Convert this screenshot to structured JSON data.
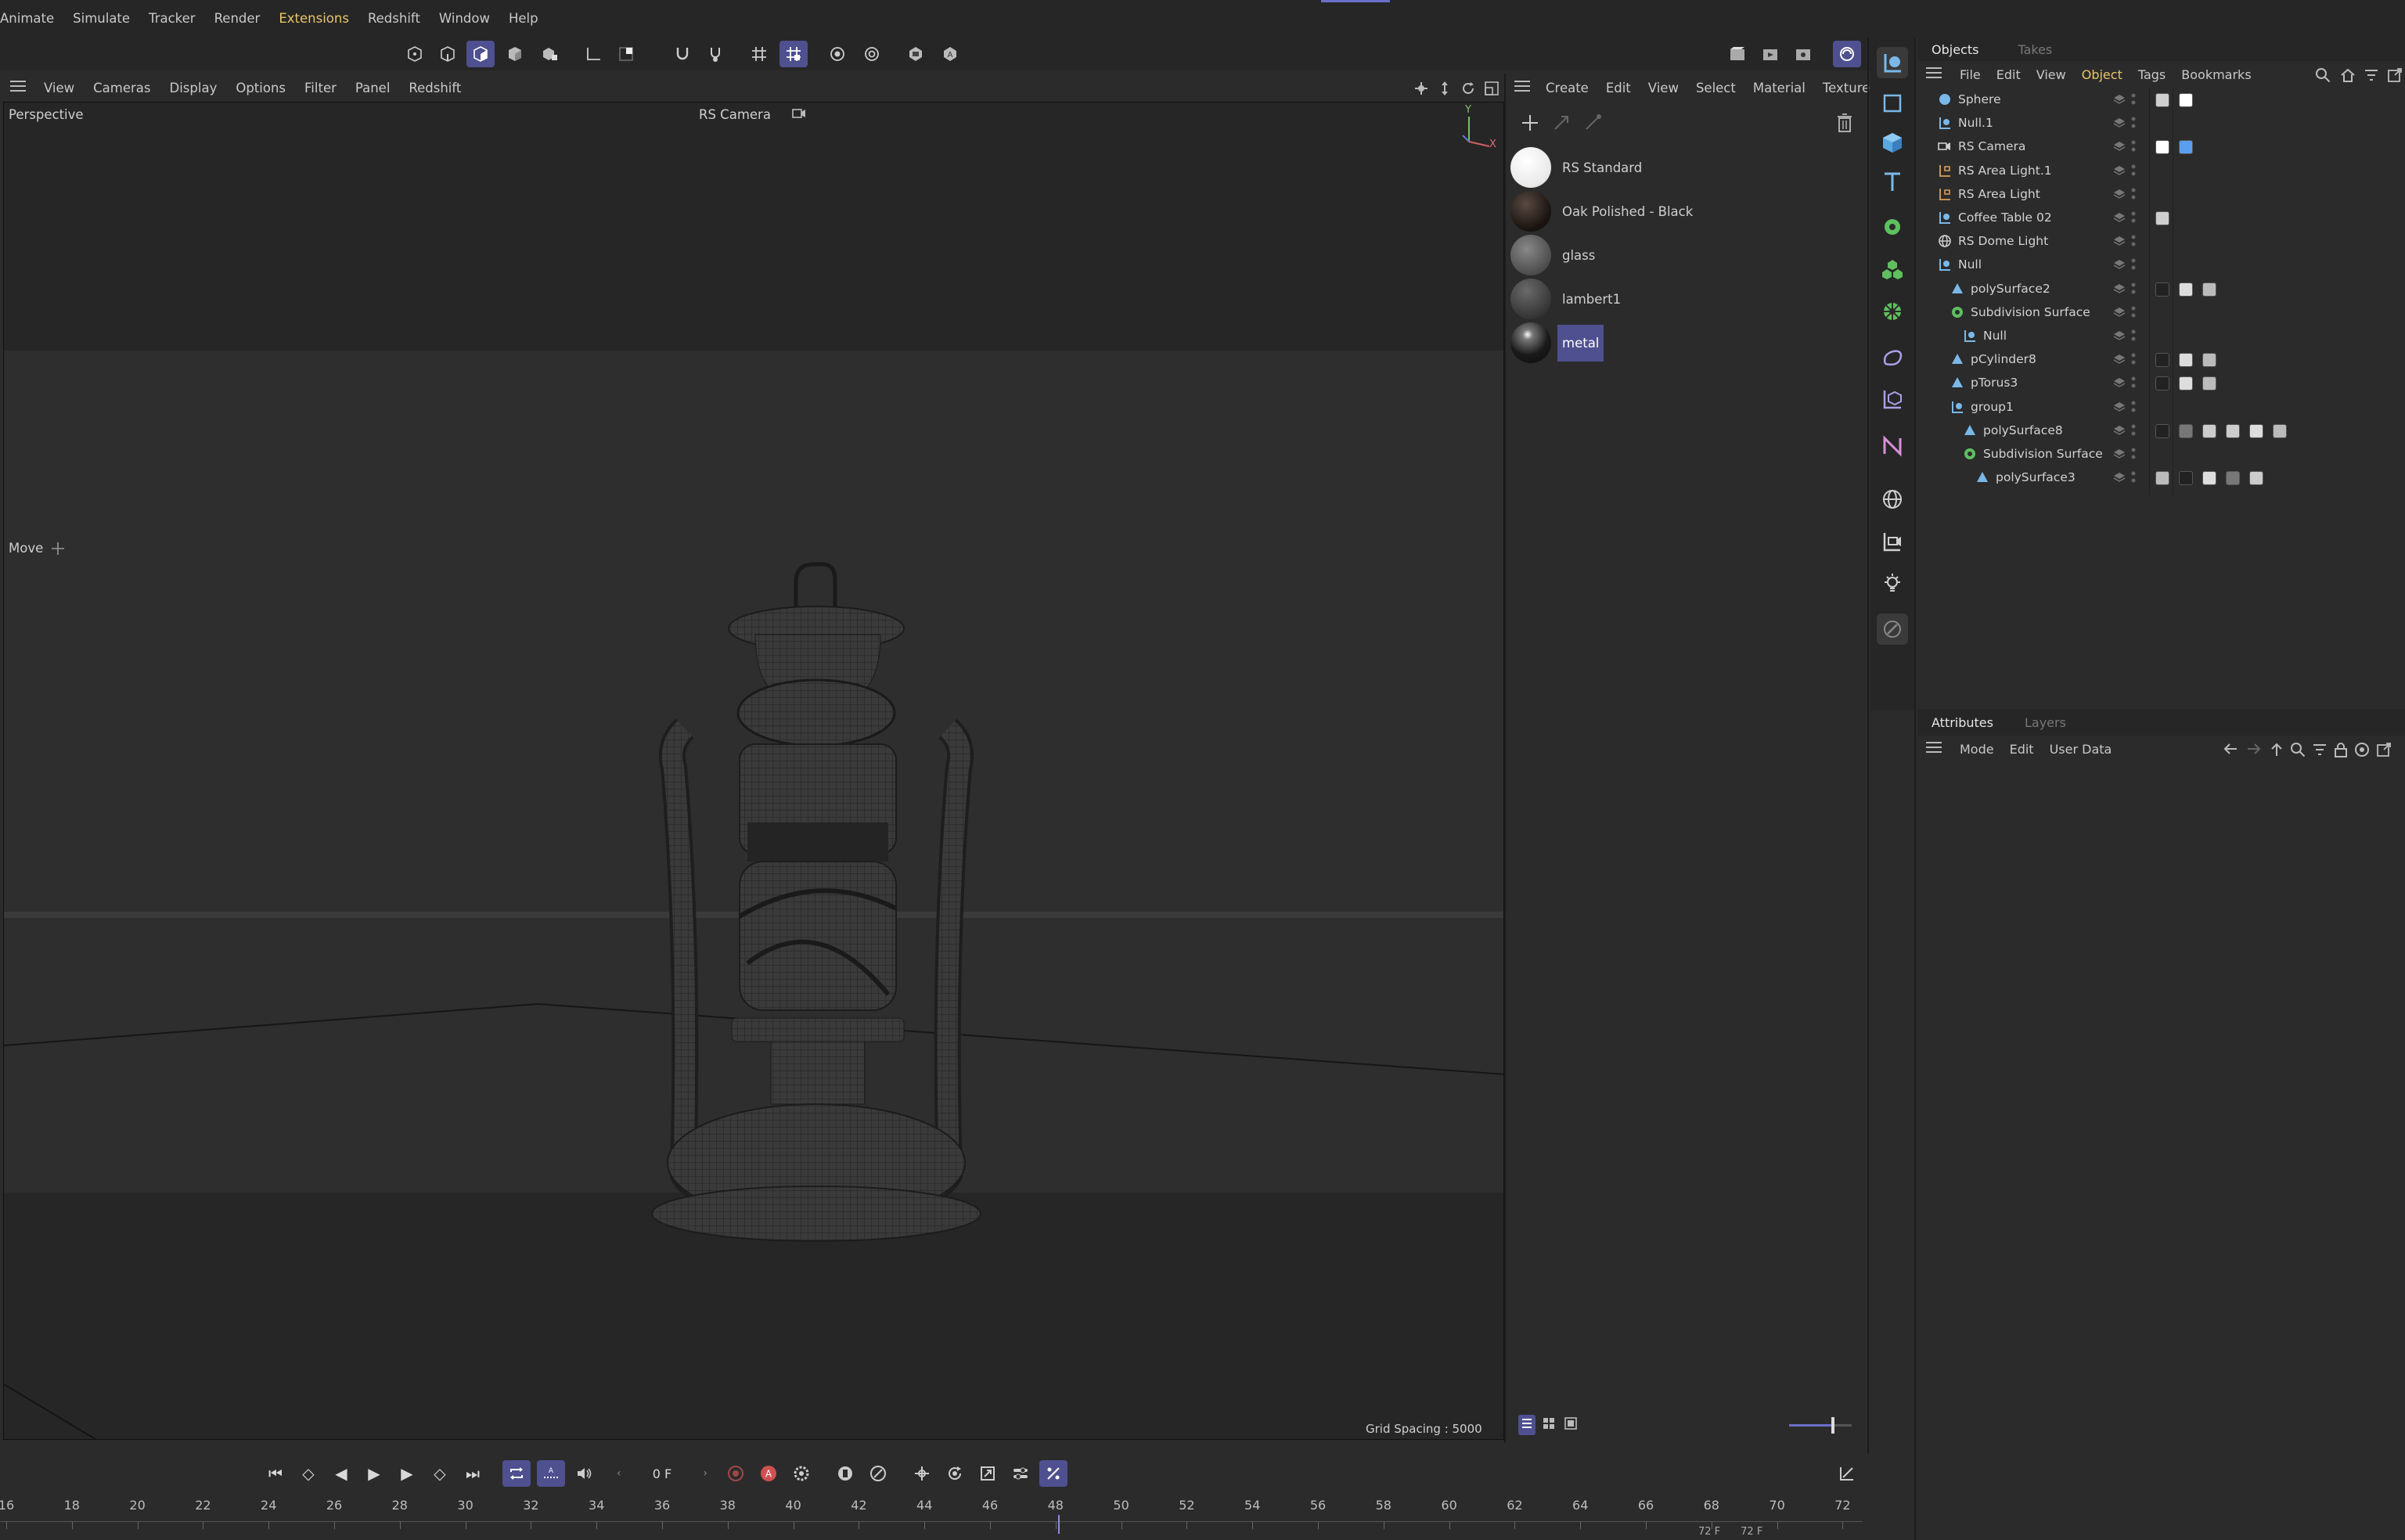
{
  "menubar": {
    "items": [
      "Animate",
      "Simulate",
      "Tracker",
      "Render",
      "Extensions",
      "Redshift",
      "Window",
      "Help"
    ],
    "active": "Extensions"
  },
  "viewport": {
    "menu": [
      "View",
      "Cameras",
      "Display",
      "Options",
      "Filter",
      "Panel",
      "Redshift"
    ],
    "view_name": "Perspective",
    "camera": "RS Camera",
    "tool": "Move",
    "grid_spacing": "Grid Spacing : 5000 cm",
    "axis_y": "Y",
    "axis_x": "X"
  },
  "materials": {
    "menu": [
      "Create",
      "Edit",
      "View",
      "Select",
      "Material",
      "Texture"
    ],
    "items": [
      {
        "name": "RS Standard",
        "color": "#f2f2f2"
      },
      {
        "name": "Oak Polished - Black",
        "color": "#2a211d"
      },
      {
        "name": "glass",
        "color": "#5a5a5a"
      },
      {
        "name": "lambert1",
        "color": "#474747"
      },
      {
        "name": "metal",
        "color": "#1e1e1e"
      }
    ],
    "selected": "metal"
  },
  "objects": {
    "tabs": [
      "Objects",
      "Takes"
    ],
    "menu": [
      "File",
      "Edit",
      "View",
      "Object",
      "Tags",
      "Bookmarks"
    ],
    "rows": [
      {
        "name": "Sphere",
        "indent": 0,
        "icon": "sphere-icon"
      },
      {
        "name": "Null.1",
        "indent": 0,
        "icon": "null-icon"
      },
      {
        "name": "RS Camera",
        "indent": 0,
        "icon": "camera-icon"
      },
      {
        "name": "RS Area Light.1",
        "indent": 0,
        "icon": "light-icon"
      },
      {
        "name": "RS Area Light",
        "indent": 0,
        "icon": "light-icon"
      },
      {
        "name": "Coffee Table 02",
        "indent": 0,
        "icon": "null-icon"
      },
      {
        "name": "RS Dome Light",
        "indent": 0,
        "icon": "globe-icon"
      },
      {
        "name": "Null",
        "indent": 0,
        "icon": "null-icon"
      },
      {
        "name": "polySurface2",
        "indent": 1,
        "icon": "poly-icon"
      },
      {
        "name": "Subdivision Surface",
        "indent": 1,
        "icon": "subdivision-icon"
      },
      {
        "name": "Null",
        "indent": 2,
        "icon": "null-icon"
      },
      {
        "name": "pCylinder8",
        "indent": 1,
        "icon": "poly-icon"
      },
      {
        "name": "pTorus3",
        "indent": 1,
        "icon": "poly-icon"
      },
      {
        "name": "group1",
        "indent": 1,
        "icon": "null-icon"
      },
      {
        "name": "polySurface8",
        "indent": 2,
        "icon": "poly-icon"
      },
      {
        "name": "Subdivision Surface",
        "indent": 2,
        "icon": "subdivision-icon"
      },
      {
        "name": "polySurface3",
        "indent": 3,
        "icon": "poly-icon"
      }
    ]
  },
  "attributes": {
    "tabs": [
      "Attributes",
      "Layers"
    ],
    "menu": [
      "Mode",
      "Edit",
      "User Data"
    ]
  },
  "timeline": {
    "current_frame": "0 F",
    "end_frame_a": "72 F",
    "end_frame_b": "72 F",
    "ticks": [
      "16",
      "18",
      "20",
      "22",
      "24",
      "26",
      "28",
      "30",
      "32",
      "34",
      "36",
      "38",
      "40",
      "42",
      "44",
      "46",
      "48",
      "50",
      "52",
      "54",
      "56",
      "58",
      "60",
      "62",
      "64",
      "66",
      "68",
      "70",
      "72"
    ]
  },
  "colors": {
    "accent": "#4e5090",
    "active_menu": "#e8c66b"
  }
}
